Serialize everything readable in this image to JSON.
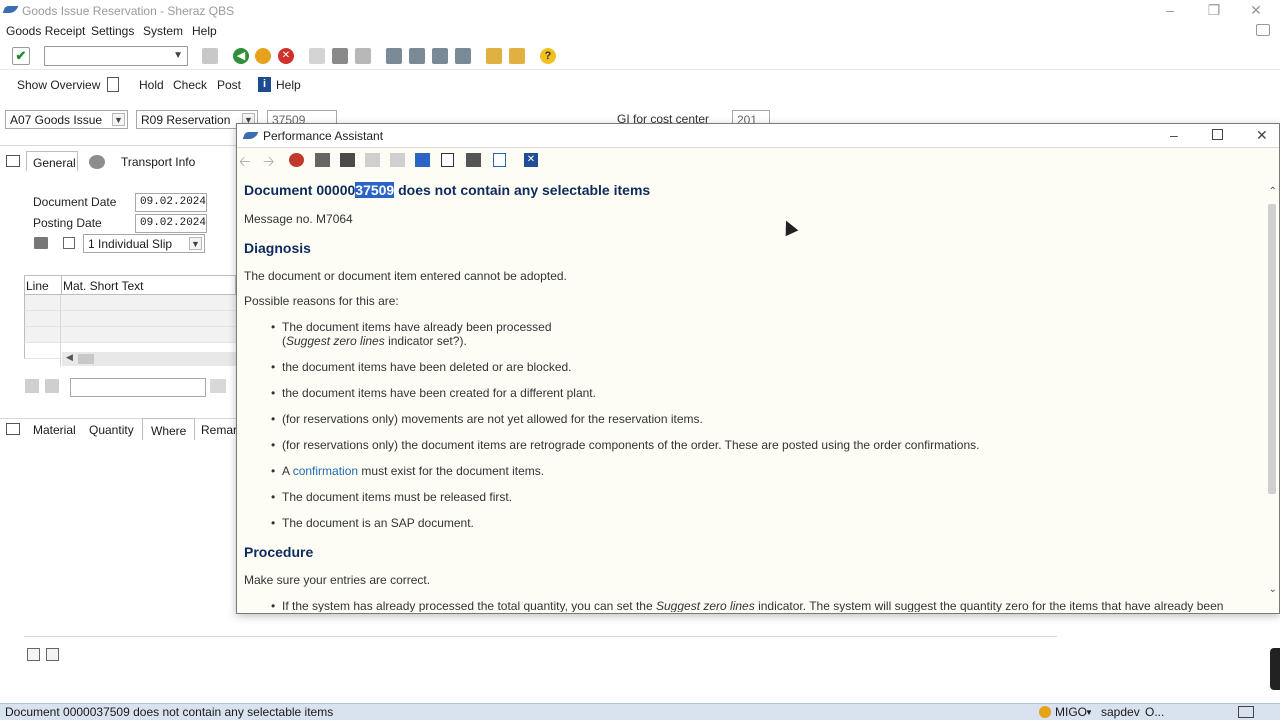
{
  "window": {
    "title": "Goods Issue Reservation - Sheraz QBS"
  },
  "menu": [
    "Goods Receipt",
    "Settings",
    "System",
    "Help"
  ],
  "toolbar2": {
    "show_overview": "Show Overview",
    "hold": "Hold",
    "check": "Check",
    "post": "Post",
    "help": "Help"
  },
  "header": {
    "action": "A07 Goods Issue",
    "ref_doc": "R09 Reservation",
    "doc_no": "37509",
    "gi_label": "GI for cost center",
    "mvt": "201"
  },
  "tabs": {
    "general": "General",
    "transport": "Transport Info"
  },
  "general": {
    "doc_date_label": "Document Date",
    "doc_date": "09.02.2024",
    "post_date_label": "Posting Date",
    "post_date": "09.02.2024",
    "slip": "1 Individual Slip"
  },
  "grid": {
    "col_line": "Line",
    "col_text": "Mat. Short Text"
  },
  "detail_tabs": [
    "Material",
    "Quantity",
    "Where",
    "Remar"
  ],
  "status": {
    "message": "Document 0000037509   does not contain any selectable items",
    "tcode": "MIGO",
    "server": "sapdev",
    "extra": "O..."
  },
  "pa": {
    "title": "Performance Assistant",
    "heading_pre": "Document 00000",
    "heading_sel": "37509",
    "heading_post": " does not contain any selectable items",
    "message_no": "Message no. M7064",
    "diagnosis": "Diagnosis",
    "diag_text": "The document or document item entered cannot be adopted.",
    "reasons_intro": "Possible reasons for this are:",
    "b1_line1": "The document items have already been processed",
    "b1_line2_pre": "(",
    "b1_line2_em": "Suggest zero lines",
    "b1_line2_post": " indicator set?).",
    "b2": "the document items have been deleted or are blocked.",
    "b3": "the document items have been created for a different plant.",
    "b4": "(for reservations only) movements are not yet allowed for the reservation items.",
    "b5": "(for reservations only) the document items are retrograde components of the order. These are posted using the order confirmations.",
    "b6_pre": "A ",
    "b6_link": "confirmation",
    "b6_post": " must exist for the document items.",
    "b7": "The document items must be released first.",
    "b8": "The document is an SAP document.",
    "procedure": "Procedure",
    "proc_text": "Make sure your entries are correct.",
    "p1_pre": "If the system has already processed the total quantity, you can set the ",
    "p1_em": "Suggest zero lines",
    "p1_post": " indicator. The system will suggest the quantity zero for the items that have already been"
  }
}
